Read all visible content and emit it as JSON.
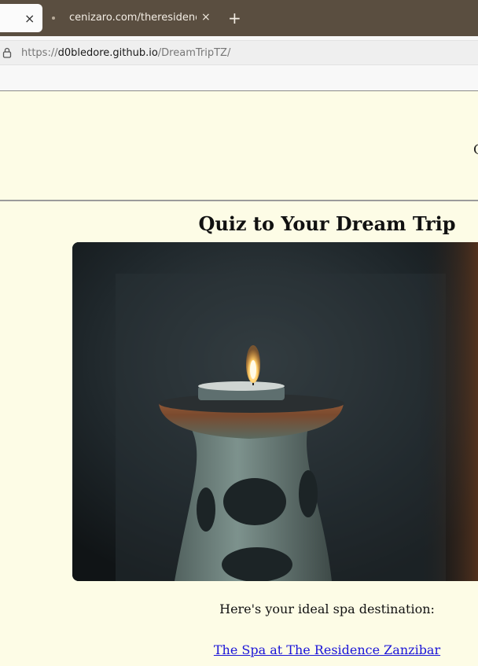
{
  "browser": {
    "active_tab": {
      "close_glyph": "×"
    },
    "second_tab": {
      "title": "cenizaro.com/theresidence",
      "close_glyph": "×"
    },
    "new_tab_glyph": "+",
    "address": {
      "scheme": "https://",
      "host": "d0bledore.github.io",
      "path": "/DreamTripTZ/"
    }
  },
  "page": {
    "header_partial_text": "Q",
    "title": "Quiz to Your Dream Trip",
    "image_alt": "candle oil burner",
    "result_text": "Here's your ideal spa destination:",
    "result_link": "The Spa at The Residence Zanzibar"
  },
  "colors": {
    "tabstrip": "#5a4e40",
    "page_background": "#fdfce6",
    "link": "#1a14d8"
  }
}
